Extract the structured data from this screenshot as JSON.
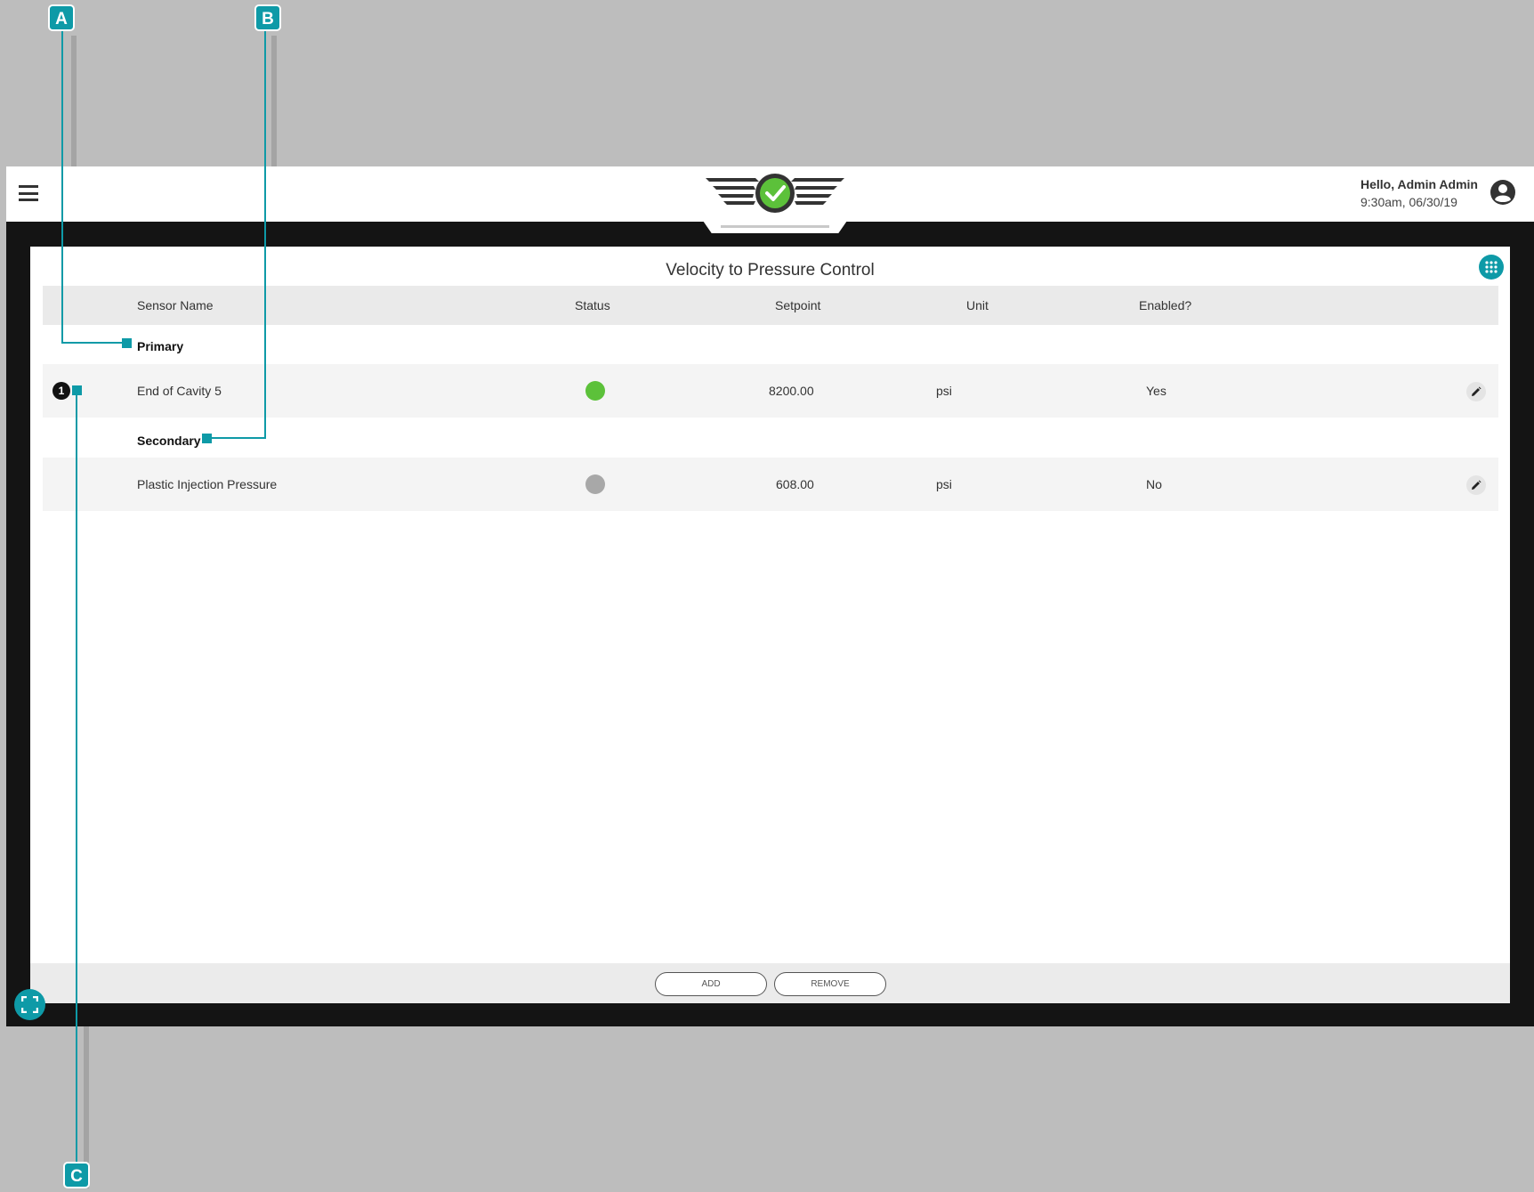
{
  "header": {
    "greeting": "Hello, Admin Admin",
    "datetime": "9:30am, 06/30/19"
  },
  "panel": {
    "title": "Velocity to Pressure Control"
  },
  "table": {
    "columns": [
      "Sensor Name",
      "Status",
      "Setpoint",
      "Unit",
      "Enabled?"
    ],
    "groups": [
      {
        "label": "Primary",
        "rows": [
          {
            "index": "1",
            "name": "End of Cavity 5",
            "status_color": "#5cc13a",
            "setpoint": "8200.00",
            "unit": "psi",
            "enabled": "Yes"
          }
        ]
      },
      {
        "label": "Secondary",
        "rows": [
          {
            "index": "",
            "name": "Plastic Injection Pressure",
            "status_color": "#a8a8a8",
            "setpoint": "608.00",
            "unit": "psi",
            "enabled": "No"
          }
        ]
      }
    ]
  },
  "footer": {
    "add_label": "ADD",
    "remove_label": "REMOVE"
  },
  "callouts": [
    "A",
    "B",
    "C"
  ],
  "colors": {
    "accent": "#0e9aa7",
    "status_on": "#5cc13a",
    "status_off": "#a8a8a8",
    "frame": "#141414"
  }
}
